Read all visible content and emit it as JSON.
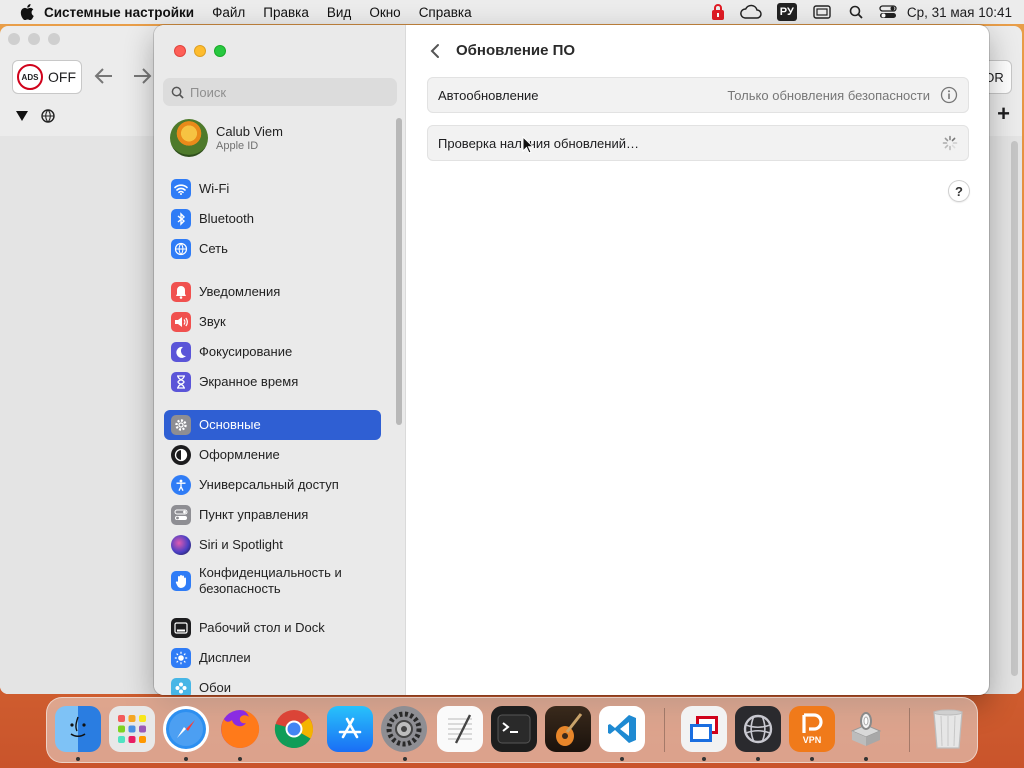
{
  "menubar": {
    "app_name": "Системные настройки",
    "menus": [
      "Файл",
      "Правка",
      "Вид",
      "Окно",
      "Справка"
    ],
    "input_source": "РУ",
    "datetime": "Ср, 31 мая  10:41",
    "icons": [
      "apple-icon",
      "lock-icon",
      "icloud-icon",
      "window-icon",
      "search-icon",
      "control-center-icon"
    ]
  },
  "browser": {
    "ads_badge": "ADS",
    "ads_state": "OFF",
    "right_button": "OR"
  },
  "settings": {
    "search_placeholder": "Поиск",
    "profile": {
      "name": "Calub Viem",
      "subtitle": "Apple ID"
    },
    "sidebar": [
      {
        "label": "Wi-Fi",
        "icon": "wifi-icon",
        "color": "#2f7cf6"
      },
      {
        "label": "Bluetooth",
        "icon": "bluetooth-icon",
        "color": "#2f7cf6"
      },
      {
        "label": "Сеть",
        "icon": "globe-icon",
        "color": "#2f7cf6"
      },
      {
        "label": "Уведомления",
        "icon": "bell-icon",
        "color": "#f0514f"
      },
      {
        "label": "Звук",
        "icon": "speaker-icon",
        "color": "#f0514f"
      },
      {
        "label": "Фокусирование",
        "icon": "moon-icon",
        "color": "#5b55d8"
      },
      {
        "label": "Экранное время",
        "icon": "hourglass-icon",
        "color": "#5b55d8"
      },
      {
        "label": "Основные",
        "icon": "gear-icon",
        "color": "#8e8e93",
        "selected": true
      },
      {
        "label": "Оформление",
        "icon": "appearance-icon",
        "color": "#1c1c1e"
      },
      {
        "label": "Универсальный доступ",
        "icon": "accessibility-icon",
        "color": "#2f7cf6"
      },
      {
        "label": "Пункт управления",
        "icon": "toggles-icon",
        "color": "#8e8e93"
      },
      {
        "label": "Siri и Spotlight",
        "icon": "siri-icon",
        "color": "#3a2d7a"
      },
      {
        "label": "Конфиденциальность и безопасность",
        "icon": "hand-icon",
        "color": "#2f7cf6"
      },
      {
        "label": "Рабочий стол и Dock",
        "icon": "dock-icon",
        "color": "#1c1c1e"
      },
      {
        "label": "Дисплеи",
        "icon": "sun-icon",
        "color": "#2f7cf6"
      },
      {
        "label": "Обои",
        "icon": "flower-icon",
        "color": "#47b6e6"
      }
    ],
    "main": {
      "title": "Обновление ПО",
      "rows": [
        {
          "label": "Автообновление",
          "value": "Только обновления безопасности"
        },
        {
          "label": "Проверка наличия обновлений…",
          "value": ""
        }
      ],
      "help": "?"
    }
  },
  "dock": {
    "apps": [
      "Finder",
      "Launchpad",
      "Safari",
      "Firefox",
      "Chrome",
      "App Store",
      "System Settings",
      "TextEdit",
      "Terminal",
      "GarageBand",
      "VS Code",
      "Parallels",
      "Browser",
      "VPN",
      "Installer",
      "Trash"
    ],
    "vpn_label": "VPN"
  }
}
